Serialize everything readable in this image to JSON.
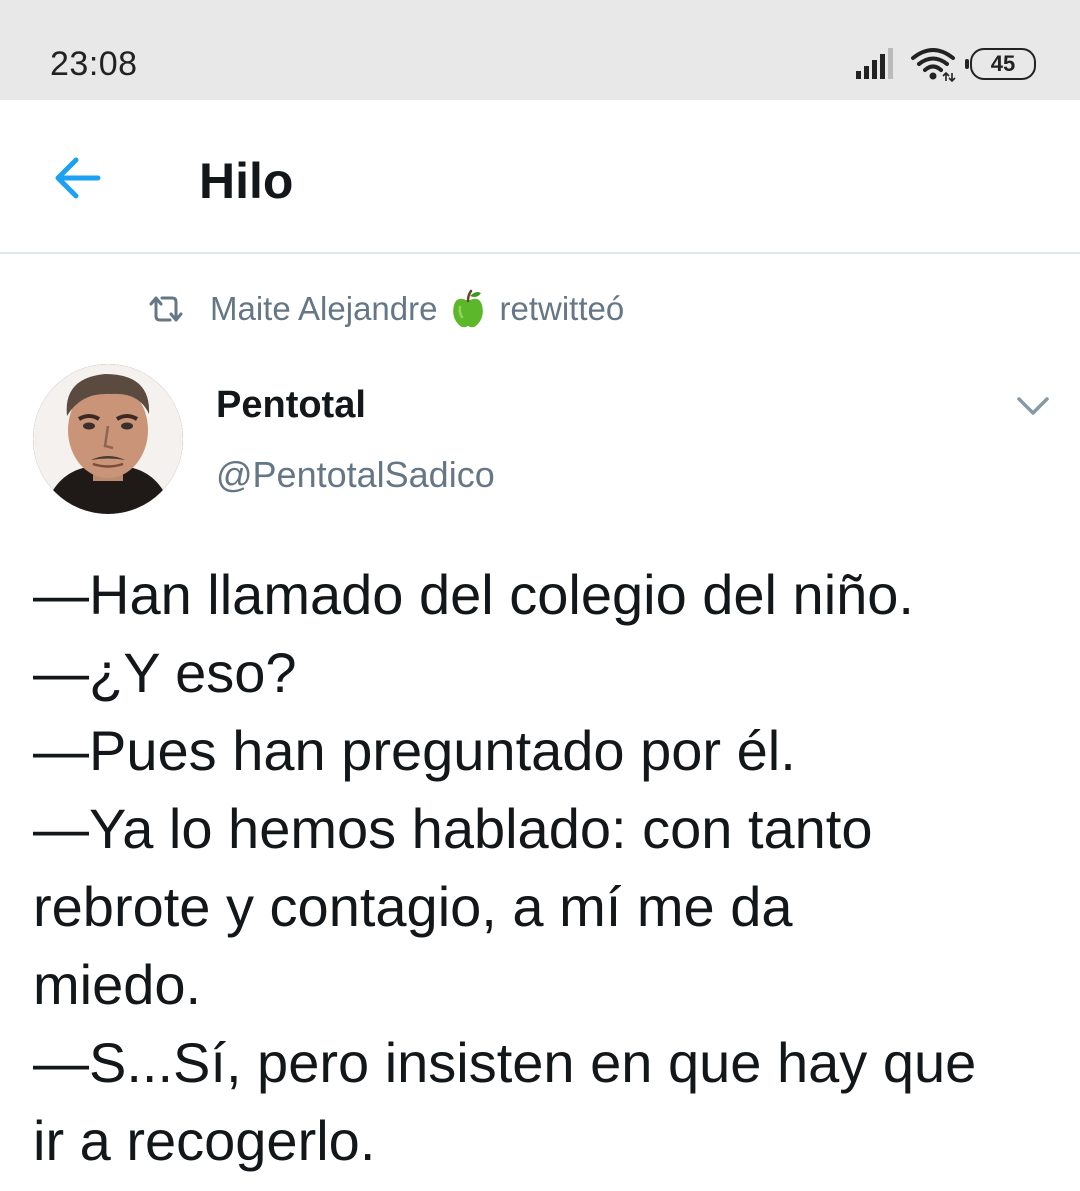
{
  "status_bar": {
    "time": "23:08",
    "battery": "45",
    "icons": [
      "signal-icon",
      "wifi-icon",
      "battery-icon"
    ]
  },
  "header": {
    "title": "Hilo",
    "back_icon": "arrow-left-icon",
    "accent_color": "#1da1f2"
  },
  "retweet_context": {
    "user": "Maite Alejandre",
    "emoji_icon": "green-apple-icon",
    "action": "retwitteó"
  },
  "tweet": {
    "author_name": "Pentotal",
    "author_handle": "@PentotalSadico",
    "more_icon": "chevron-down-icon",
    "lines": [
      "—Han llamado del colegio del niño.",
      "—¿Y eso?",
      "—Pues han preguntado por él.",
      "—Ya lo hemos hablado: con tanto",
      "rebrote y contagio, a mí me da",
      "miedo.",
      "—S...Sí, pero insisten en que hay que",
      "ir a recogerlo."
    ]
  }
}
